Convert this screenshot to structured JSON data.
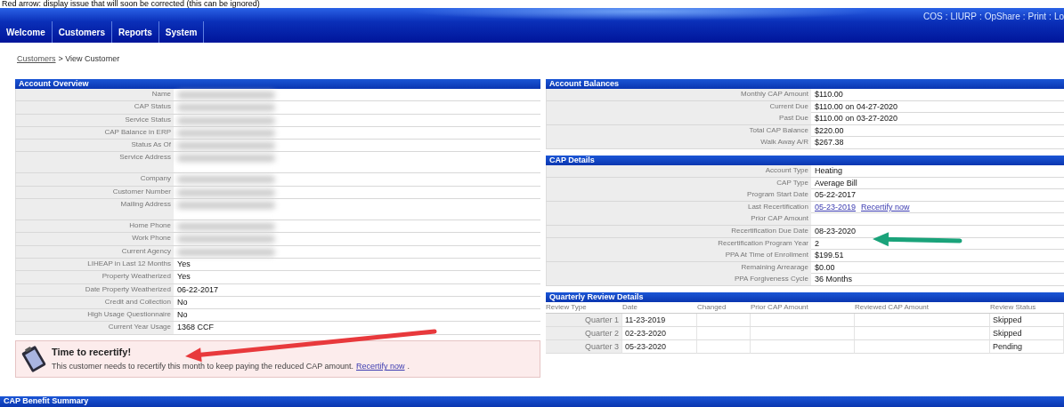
{
  "caption": "Red arrow: display issue that will soon be corrected (this can be ignored)",
  "header": {
    "top_links": [
      "COS",
      "LIURP",
      "OpShare",
      "Print",
      "Lo"
    ],
    "link_separator": ":"
  },
  "tabs": [
    {
      "label": "Welcome"
    },
    {
      "label": "Customers"
    },
    {
      "label": "Reports"
    },
    {
      "label": "System"
    }
  ],
  "breadcrumb": {
    "link": "Customers",
    "current": "> View Customer"
  },
  "account_overview": {
    "title": "Account Overview",
    "rows": [
      {
        "label": "Name",
        "redacted": true
      },
      {
        "label": "CAP Status",
        "redacted": true
      },
      {
        "label": "Service Status",
        "redacted": true
      },
      {
        "label": "CAP Balance in ERP",
        "redacted": true
      },
      {
        "label": "Status As Of",
        "redacted": true
      },
      {
        "label": "Service Address",
        "redacted": true,
        "tall": true
      },
      {
        "label": "Company",
        "redacted": true
      },
      {
        "label": "Customer Number",
        "redacted": true
      },
      {
        "label": "Mailing Address",
        "redacted": true,
        "tall": true
      },
      {
        "label": "Home Phone",
        "redacted": true
      },
      {
        "label": "Work Phone",
        "redacted": true
      },
      {
        "label": "Current Agency",
        "redacted": true
      },
      {
        "label": "LIHEAP in Last 12 Months",
        "value": "Yes"
      },
      {
        "label": "Property Weatherized",
        "value": "Yes"
      },
      {
        "label": "Date Property Weatherized",
        "value": "06-22-2017"
      },
      {
        "label": "Credit and Collection",
        "value": "No"
      },
      {
        "label": "High Usage Questionnaire",
        "value": "No"
      },
      {
        "label": "Current Year Usage",
        "value": "1368 CCF"
      }
    ]
  },
  "alert": {
    "title": "Time to recertify!",
    "message": "This customer needs to recertify this month to keep paying the reduced CAP amount.",
    "link": "Recertify now",
    "end": "."
  },
  "account_balances": {
    "title": "Account Balances",
    "rows": [
      {
        "label": "Monthly CAP Amount",
        "value": "$110.00"
      },
      {
        "label": "Current Due",
        "value": "$110.00 on 04-27-2020"
      },
      {
        "label": "Past Due",
        "value": "$110.00 on 03-27-2020"
      },
      {
        "label": "Total CAP Balance",
        "value": "$220.00"
      },
      {
        "label": "Walk Away A/R",
        "value": "$267.38"
      }
    ]
  },
  "cap_details": {
    "title": "CAP Details",
    "rows": [
      {
        "label": "Account Type",
        "value": "Heating"
      },
      {
        "label": "CAP Type",
        "value": "Average Bill"
      },
      {
        "label": "Program Start Date",
        "value": "05-22-2017"
      },
      {
        "label": "Last Recertification",
        "value": "05-23-2019",
        "link": "Recertify now"
      },
      {
        "label": "Prior CAP Amount"
      },
      {
        "label": "Recertification Due Date",
        "value": "08-23-2020"
      },
      {
        "label": "Recertification Program Year",
        "value": "2"
      },
      {
        "label": "PPA At Time of Enrollment",
        "value": "$199.51"
      },
      {
        "label": "Remaining Arrearage",
        "value": "$0.00"
      },
      {
        "label": "PPA Forgiveness Cycle",
        "value": "36 Months"
      }
    ]
  },
  "quarterly_review": {
    "title": "Quarterly Review Details",
    "columns": [
      "Review Type",
      "Date",
      "Changed",
      "Prior CAP Amount",
      "Reviewed CAP Amount",
      "Review Status"
    ],
    "rows": [
      [
        "Quarter 1",
        "11-23-2019",
        "",
        "",
        "",
        "Skipped"
      ],
      [
        "Quarter 2",
        "02-23-2020",
        "",
        "",
        "",
        "Skipped"
      ],
      [
        "Quarter 3",
        "05-23-2020",
        "",
        "",
        "",
        "Pending"
      ]
    ]
  },
  "annotations": [
    {
      "kind": "arrow",
      "color": "#e8393c"
    },
    {
      "kind": "arrow",
      "color": "#1aa37a"
    }
  ],
  "footer_section": {
    "title": "CAP Benefit Summary"
  }
}
